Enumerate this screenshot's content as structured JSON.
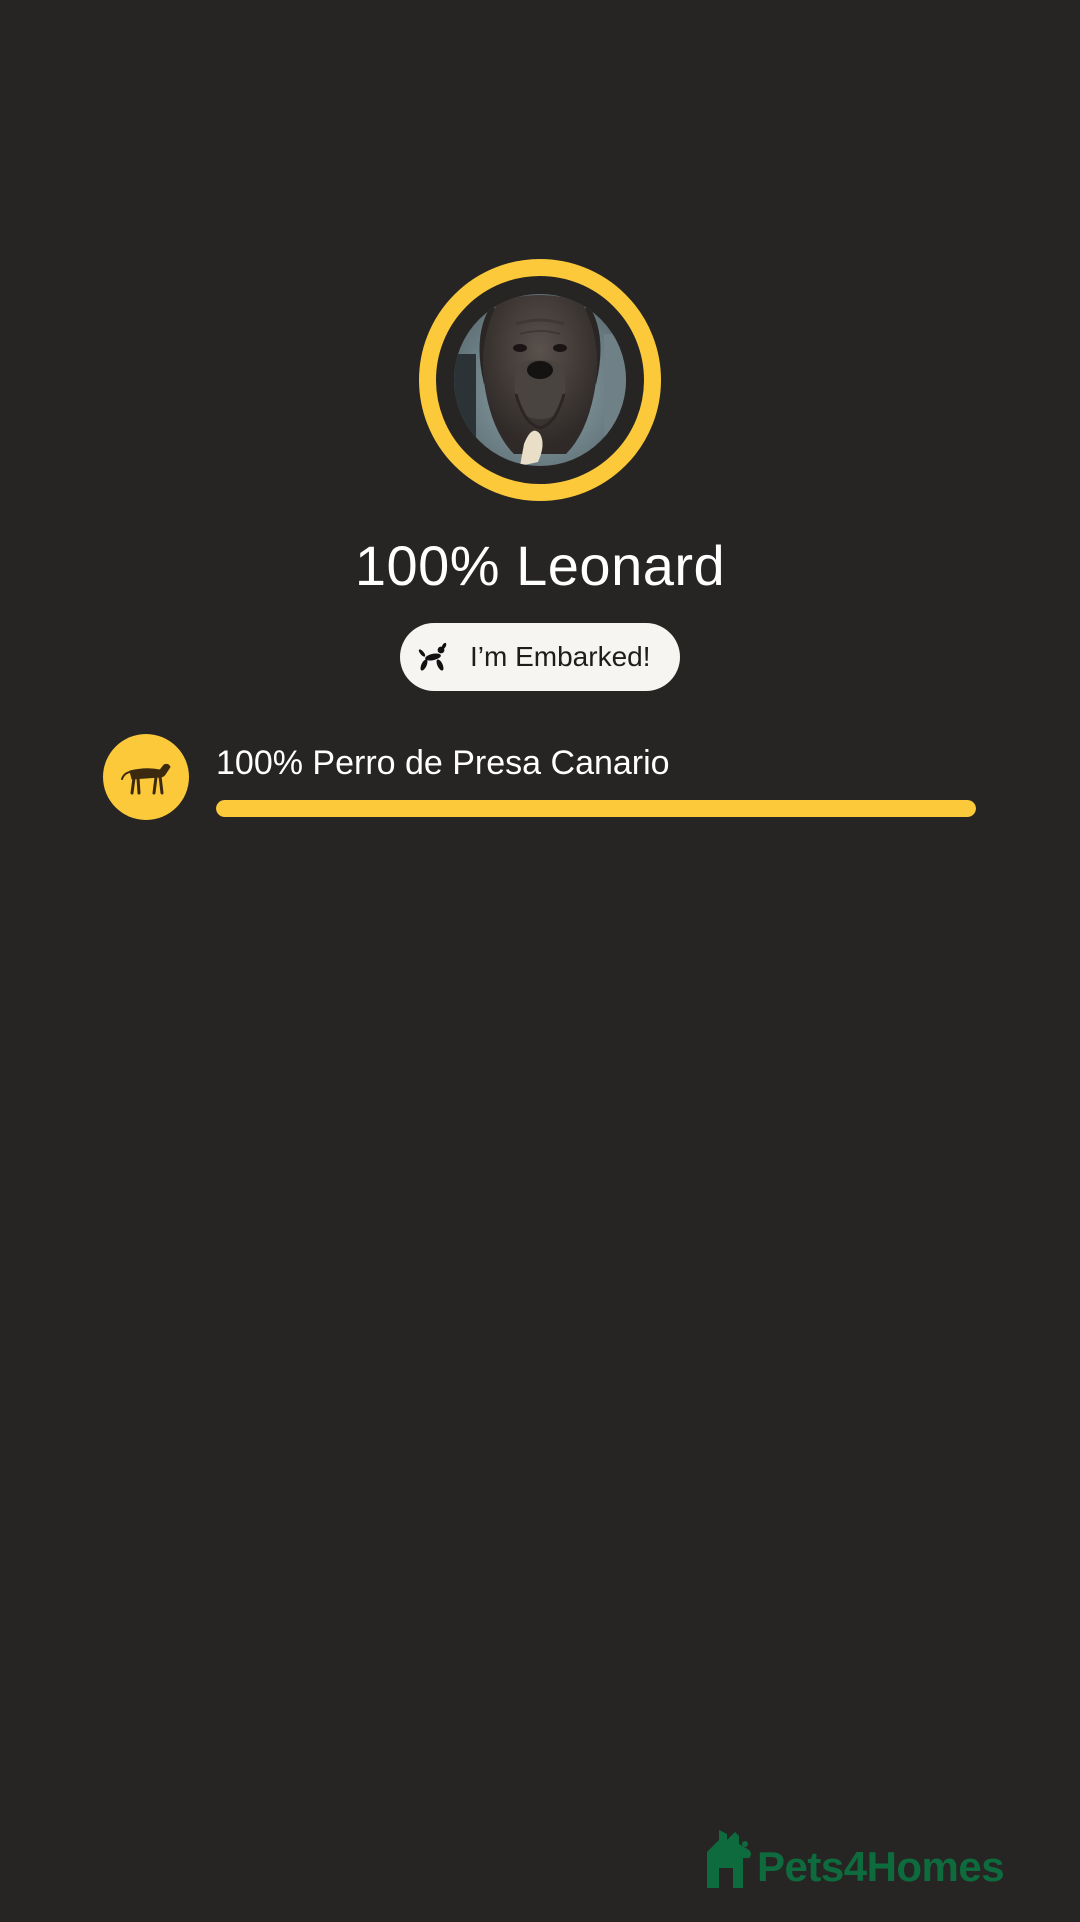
{
  "profile": {
    "title": "100% Leonard",
    "photo_icon": "dog-photo",
    "embark_badge": {
      "label": "I’m Embarked!",
      "icon": "balloon-dog-icon"
    }
  },
  "breeds": [
    {
      "label": "100% Perro de Presa Canario",
      "percent": 100,
      "icon": "dog-breed-icon"
    }
  ],
  "brand": {
    "name": "Pets4Homes",
    "icon": "pets4homes-logo-icon"
  },
  "colors": {
    "background": "#262524",
    "accent": "#fbc93a",
    "pill": "#f6f5f2",
    "brand": "#0e6b3d"
  }
}
